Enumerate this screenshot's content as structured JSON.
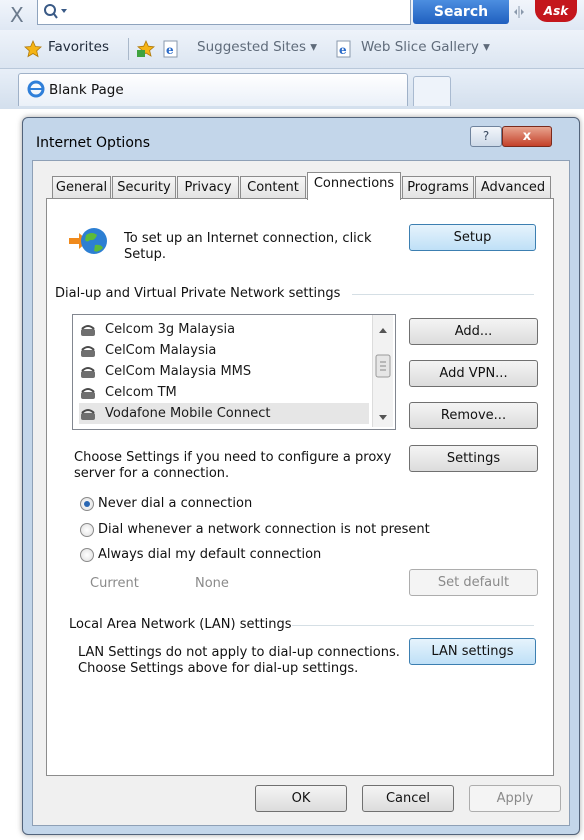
{
  "browser": {
    "close_glyph": "X",
    "search_button": "Search",
    "ask_logo": "Ask",
    "favorites_label": "Favorites",
    "suggested_sites": "Suggested Sites ▾",
    "web_slice_gallery": "Web Slice Gallery ▾",
    "tab_title": "Blank Page"
  },
  "dialog": {
    "title": "Internet Options",
    "help_glyph": "?",
    "close_glyph": "x",
    "tabs": [
      "General",
      "Security",
      "Privacy",
      "Content",
      "Connections",
      "Programs",
      "Advanced"
    ],
    "active_tab": "Connections",
    "setup_text_line1": "To set up an Internet connection, click",
    "setup_text_line2": "Setup.",
    "setup_button": "Setup",
    "dialup_group": "Dial-up and Virtual Private Network settings",
    "connections": [
      "Celcom 3g Malaysia",
      "CelCom Malaysia",
      "CelCom Malaysia MMS",
      "Celcom TM",
      "Vodafone Mobile Connect"
    ],
    "add_button": "Add...",
    "add_vpn_button": "Add VPN...",
    "remove_button": "Remove...",
    "proxy_text_line1": "Choose Settings if you need to configure a proxy",
    "proxy_text_line2": "server for a connection.",
    "settings_button": "Settings",
    "radio_never": "Never dial a connection",
    "radio_whenever": "Dial whenever a network connection is not present",
    "radio_always": "Always dial my default connection",
    "current_label": "Current",
    "current_value": "None",
    "set_default_button": "Set default",
    "lan_group": "Local Area Network (LAN) settings",
    "lan_text_line1": "LAN Settings do not apply to dial-up connections.",
    "lan_text_line2": "Choose Settings above for dial-up settings.",
    "lan_button": "LAN settings",
    "ok_button": "OK",
    "cancel_button": "Cancel",
    "apply_button": "Apply"
  }
}
